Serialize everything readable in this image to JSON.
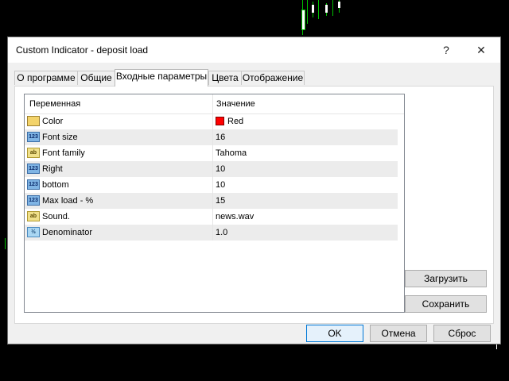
{
  "window": {
    "title": "Custom Indicator - deposit load",
    "help_glyph": "?",
    "close_glyph": "✕"
  },
  "tabs": [
    {
      "label": "О программе"
    },
    {
      "label": "Общие"
    },
    {
      "label": "Входные параметры"
    },
    {
      "label": "Цвета"
    },
    {
      "label": "Отображение"
    }
  ],
  "grid": {
    "headers": {
      "variable": "Переменная",
      "value": "Значение"
    },
    "rows": [
      {
        "icon": "color-icon",
        "name": "Color",
        "value": "Red"
      },
      {
        "icon": "integer-icon",
        "name": "Font size",
        "value": "16"
      },
      {
        "icon": "string-icon",
        "name": "Font family",
        "value": "Tahoma"
      },
      {
        "icon": "integer-icon",
        "name": "Right",
        "value": "10"
      },
      {
        "icon": "integer-icon",
        "name": "bottom",
        "value": "10"
      },
      {
        "icon": "integer-icon",
        "name": "Max load - %",
        "value": "15"
      },
      {
        "icon": "string-icon",
        "name": "Sound.",
        "value": "news.wav"
      },
      {
        "icon": "double-icon",
        "name": "Denominator",
        "value": "1.0"
      }
    ]
  },
  "side_buttons": {
    "load": "Загрузить",
    "save": "Сохранить"
  },
  "footer_buttons": {
    "ok": "OK",
    "cancel": "Отмена",
    "reset": "Сброс"
  },
  "colors": {
    "accent": "#0078d7",
    "color_param": "#ff0000",
    "chart_bull": "#00c000"
  }
}
